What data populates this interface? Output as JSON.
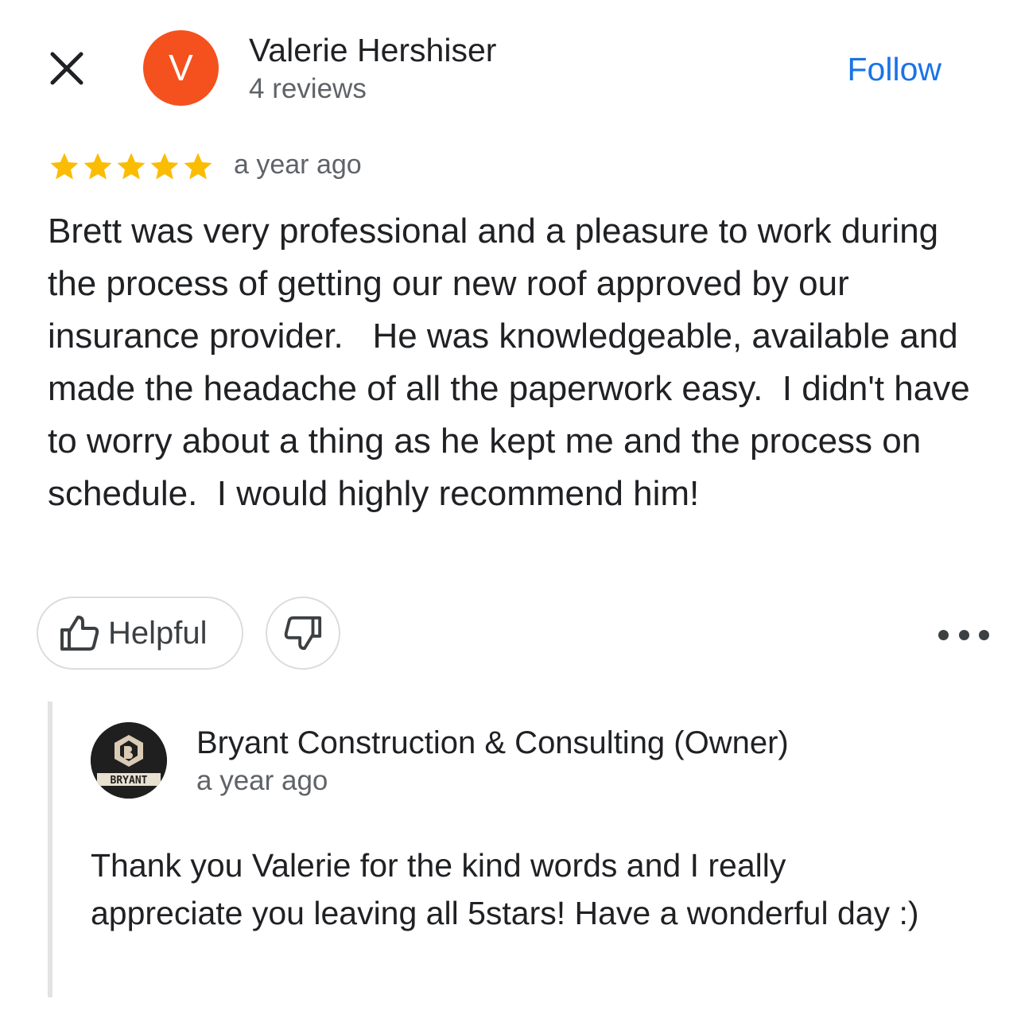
{
  "review": {
    "reviewer": {
      "name": "Valerie Hershiser",
      "initial": "V",
      "reviews_count": "4 reviews",
      "avatar_color": "#f4511e"
    },
    "follow_label": "Follow",
    "rating": 5,
    "rating_max": 5,
    "time": "a year ago",
    "text": "Brett was very professional and a pleasure to work during the process of getting our new roof approved by our insurance provider.   He was knowledgeable, available and made the headache of all the paperwork easy.  I didn't have to worry about a thing as he kept me and the process on schedule.  I would highly recommend him!",
    "actions": {
      "helpful_label": "Helpful",
      "helpful_icon": "thumbs-up-icon",
      "unhelpful_icon": "thumbs-down-icon",
      "more_icon": "more-horizontal-icon"
    }
  },
  "owner_reply": {
    "name": "Bryant Construction & Consulting (Owner)",
    "logo_text": "BRYANT",
    "time": "a year ago",
    "text": "Thank you Valerie for the kind words and I really appreciate you leaving all 5stars! Have a wonderful day :)"
  },
  "colors": {
    "accent": "#1a73e8",
    "star": "#fbbc04",
    "secondary_text": "#5f6368",
    "border": "#dadce0"
  }
}
